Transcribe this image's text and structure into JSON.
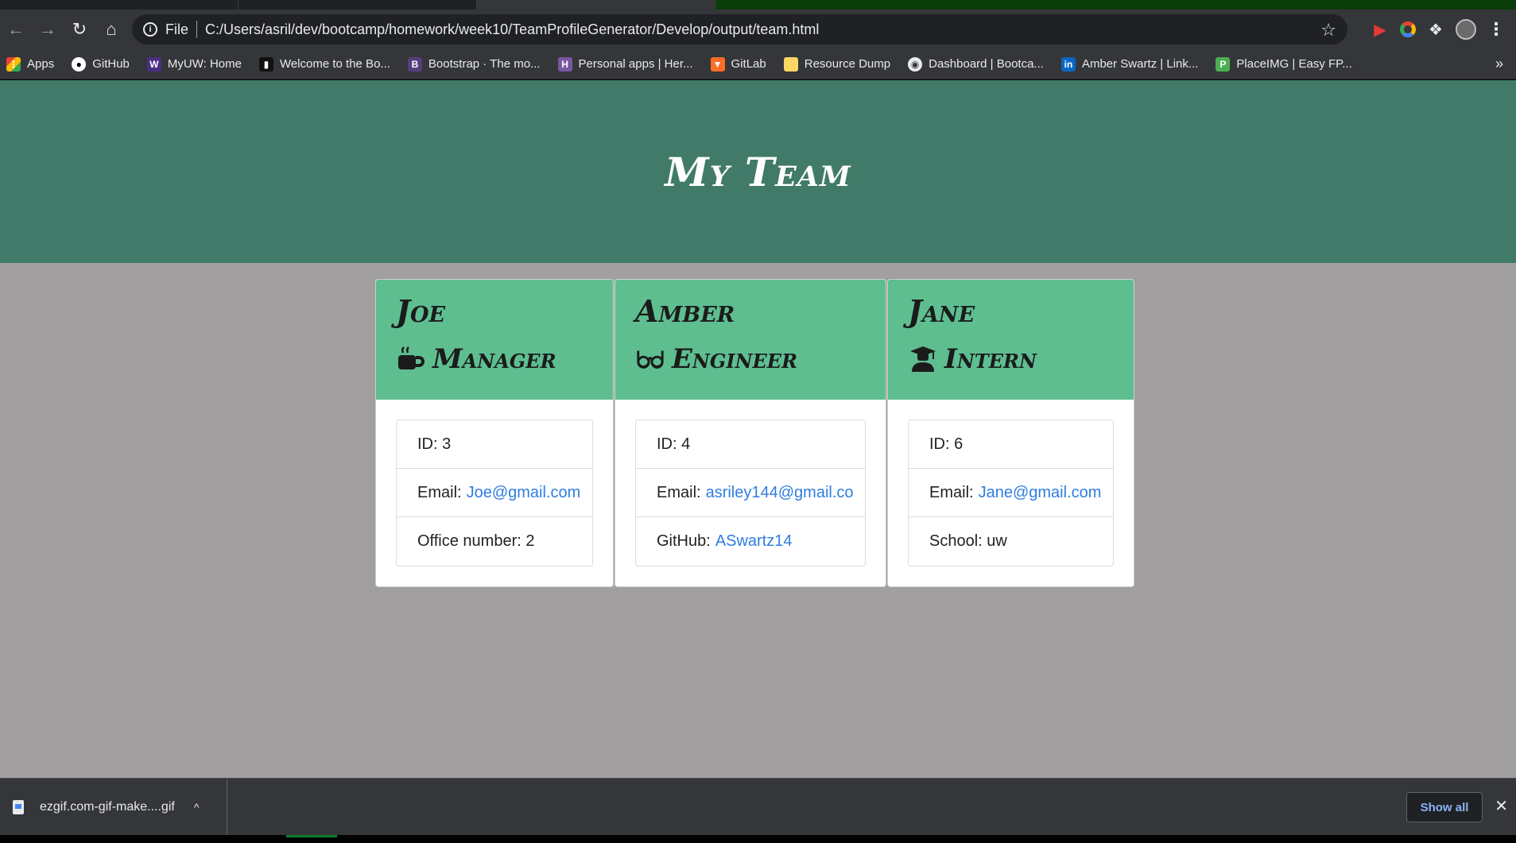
{
  "browser": {
    "scheme_label": "File",
    "url": "C:/Users/asril/dev/bootcamp/homework/week10/TeamProfileGenerator/Develop/output/team.html"
  },
  "bookmarks": [
    {
      "label": "Apps",
      "icon": "apps-grid-icon",
      "color": "#ea4335"
    },
    {
      "label": "GitHub",
      "icon": "github-icon",
      "color": "#ffffff"
    },
    {
      "label": "MyUW: Home",
      "icon": "uw-w-icon",
      "color": "#4b2e83"
    },
    {
      "label": "Welcome to the Bo...",
      "icon": "book-icon",
      "color": "#202124"
    },
    {
      "label": "Bootstrap · The mo...",
      "icon": "bootstrap-b-icon",
      "color": "#563d7c"
    },
    {
      "label": "Personal apps | Her...",
      "icon": "heroku-icon",
      "color": "#79589f"
    },
    {
      "label": "GitLab",
      "icon": "gitlab-icon",
      "color": "#fc6d26"
    },
    {
      "label": "Resource Dump",
      "icon": "note-icon",
      "color": "#fdd663"
    },
    {
      "label": "Dashboard | Bootca...",
      "icon": "globe-icon",
      "color": "#e8eaed"
    },
    {
      "label": "Amber Swartz | Link...",
      "icon": "linkedin-icon",
      "color": "#0a66c2"
    },
    {
      "label": "PlaceIMG | Easy FP...",
      "icon": "placeimg-p-icon",
      "color": "#4caf50"
    }
  ],
  "page": {
    "title": "My Team",
    "header_color": "#417a68",
    "card_header_color": "#5ebe90",
    "background_color": "#a29fa0",
    "link_color": "#2f7de1"
  },
  "team": [
    {
      "name": "Joe",
      "role": "Manager",
      "role_icon": "coffee-mug-icon",
      "id_text": "ID: 3",
      "email_label": "Email:",
      "email": "Joe@gmail.com",
      "extra_label": "Office number: 2",
      "extra_value": ""
    },
    {
      "name": "Amber",
      "role": "Engineer",
      "role_icon": "glasses-icon",
      "id_text": "ID: 4",
      "email_label": "Email:",
      "email": "asriley144@gmail.co",
      "extra_label": "GitHub:",
      "extra_value": "ASwartz14"
    },
    {
      "name": "Jane",
      "role": "Intern",
      "role_icon": "graduate-icon",
      "id_text": "ID: 6",
      "email_label": "Email:",
      "email": "Jane@gmail.com",
      "extra_label": "School: uw",
      "extra_value": ""
    }
  ],
  "downloads": {
    "file_name": "ezgif.com-gif-make....gif",
    "show_all_label": "Show all"
  }
}
